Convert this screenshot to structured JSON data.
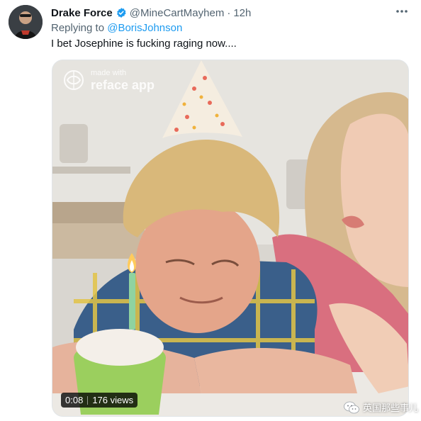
{
  "tweet": {
    "display_name": "Drake Force",
    "handle": "@MineCartMayhem",
    "separator": "·",
    "time": "12h",
    "verified_icon": "verified-badge-icon",
    "more_icon": "more-horizontal-icon",
    "replying_prefix": "Replying to",
    "replying_to": "@BorisJohnson",
    "text": "I bet Josephine is fucking raging now...."
  },
  "media": {
    "watermark_small": "made with",
    "watermark_big": "reface app",
    "duration": "0:08",
    "views": "176 views"
  },
  "overlay": {
    "source_label": "英国那些事儿",
    "source_icon": "wechat-icon"
  },
  "colors": {
    "accent": "#1d9bf0",
    "secondary_text": "#536471",
    "primary_text": "#0f1419"
  }
}
